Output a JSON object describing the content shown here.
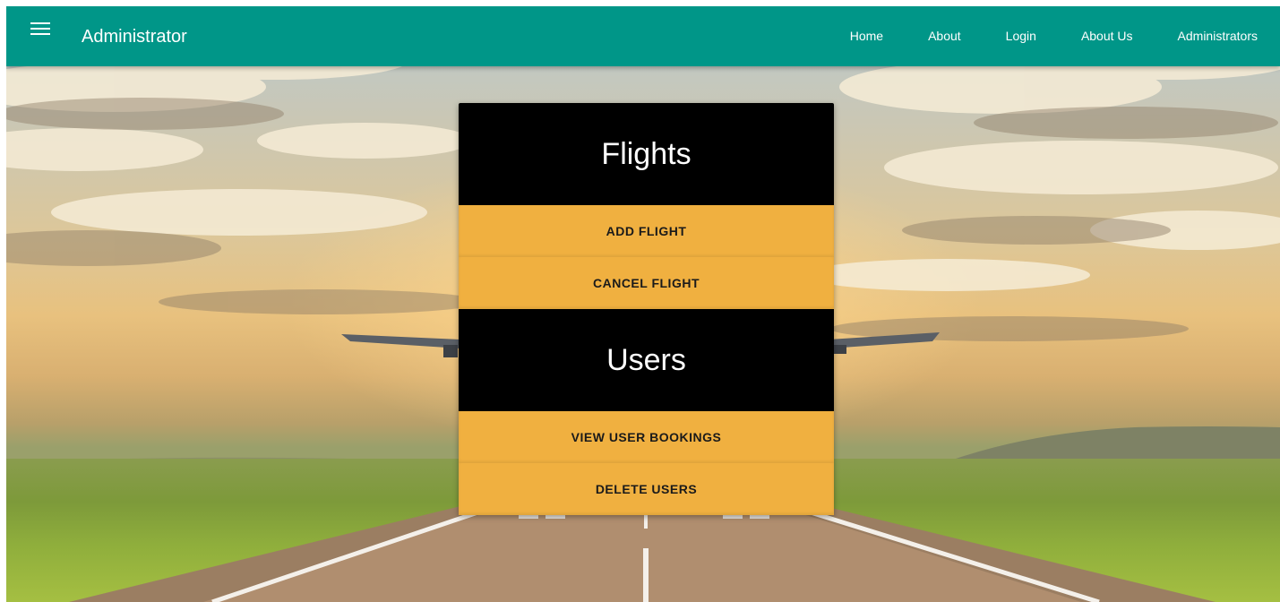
{
  "app": {
    "title": "Administrator"
  },
  "nav": {
    "items": [
      {
        "label": "Home"
      },
      {
        "label": "About"
      },
      {
        "label": "Login"
      },
      {
        "label": "About Us"
      },
      {
        "label": "Administrators"
      }
    ]
  },
  "panel": {
    "flights": {
      "heading": "Flights",
      "actions": [
        {
          "label": "ADD FLIGHT"
        },
        {
          "label": "CANCEL FLIGHT"
        }
      ]
    },
    "users": {
      "heading": "Users",
      "actions": [
        {
          "label": "VIEW USER BOOKINGS"
        },
        {
          "label": "DELETE USERS"
        }
      ]
    }
  },
  "colors": {
    "appbar": "#009688",
    "section_header": "#000000",
    "action_button": "#f0b040",
    "text_on_dark": "#ffffff"
  },
  "icons": {
    "menu": "menu-icon"
  }
}
